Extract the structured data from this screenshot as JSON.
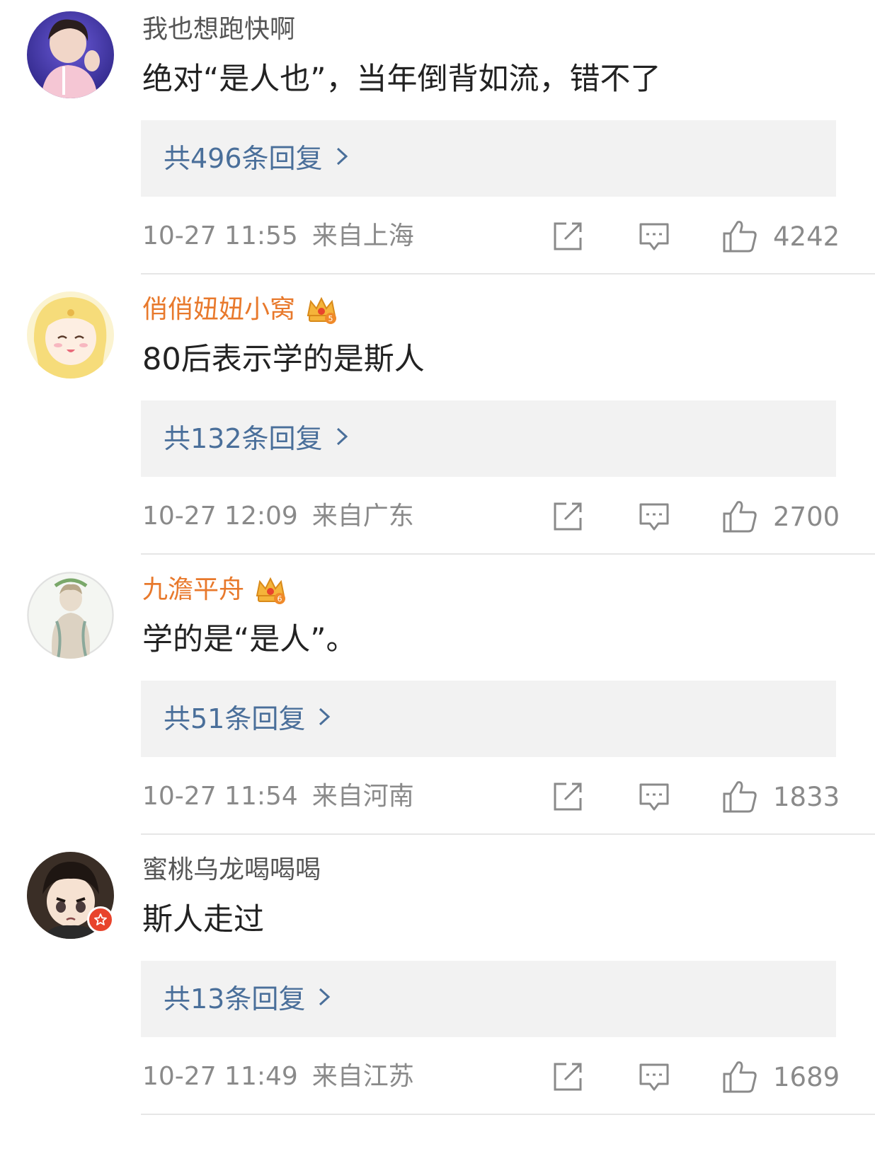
{
  "comments": [
    {
      "username": "我也想跑快啊",
      "vip": false,
      "verified": false,
      "content": "绝对“是人也”，当年倒背如流，错不了",
      "reply_label": "共496条回复",
      "time": "10-27 11:55",
      "source": "来自上海",
      "likes": "4242"
    },
    {
      "username": "俏俏妞妞小窝",
      "vip": true,
      "vip_level": "5",
      "verified": false,
      "content": "80后表示学的是斯人",
      "reply_label": "共132条回复",
      "time": "10-27 12:09",
      "source": "来自广东",
      "likes": "2700"
    },
    {
      "username": "九澹平舟",
      "vip": true,
      "vip_level": "6",
      "verified": false,
      "content": "学的是“是人”。",
      "reply_label": "共51条回复",
      "time": "10-27 11:54",
      "source": "来自河南",
      "likes": "1833"
    },
    {
      "username": "蜜桃乌龙喝喝喝",
      "vip": false,
      "verified": true,
      "content": "斯人走过",
      "reply_label": "共13条回复",
      "time": "10-27 11:49",
      "source": "来自江苏",
      "likes": "1689"
    }
  ],
  "icons": {
    "share": "share-icon",
    "comment": "comment-icon",
    "like": "thumbs-up-icon",
    "chevron": "chevron-right-icon",
    "crown": "vip-crown-icon"
  },
  "colors": {
    "vip_name": "#e8792c",
    "reply_link": "#4a6f9a",
    "meta": "#8a8a8a",
    "reply_bg": "#f2f2f2"
  }
}
